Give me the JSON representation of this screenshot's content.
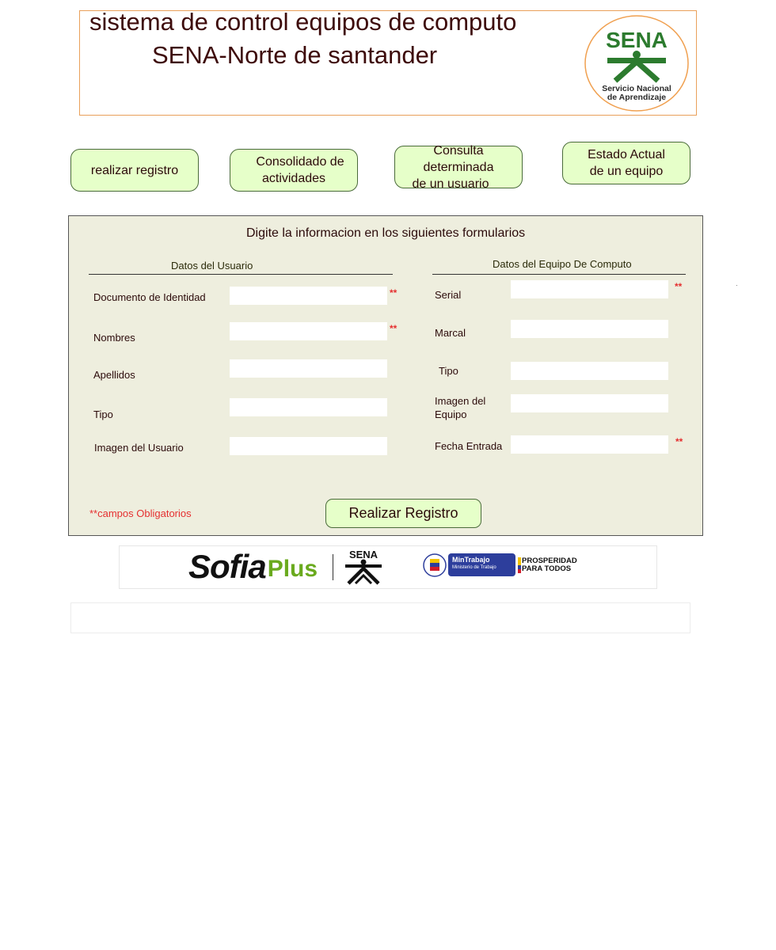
{
  "header": {
    "title_line1": "sistema de control equipos de computo",
    "title_line2": "SENA-Norte de santander",
    "logo": {
      "icon": "sena-logo-icon",
      "brand": "SENA",
      "line1": "Servicio Nacional",
      "line2": "de Aprendizaje",
      "color": "#2c7b2e",
      "ring_color": "#f0a050"
    }
  },
  "nav": {
    "register": "realizar registro",
    "consolidated_l1": "Consolidado de",
    "consolidated_l2": "actividades",
    "query_l1": "Consulta determinada",
    "query_l2": "de un usuario",
    "status_l1": "Estado Actual",
    "status_l2": "de un equipo"
  },
  "form": {
    "heading": "Digite la informacion en los siguientes formularios",
    "user_section": {
      "title": "Datos del Usuario",
      "fields": [
        {
          "label": "Documento de Identidad",
          "value": "",
          "required": true
        },
        {
          "label": "Nombres",
          "value": "",
          "required": true
        },
        {
          "label": "Apellidos",
          "value": "",
          "required": false
        },
        {
          "label": "Tipo",
          "value": "",
          "required": false
        },
        {
          "label": "Imagen del Usuario",
          "value": "",
          "required": false
        }
      ]
    },
    "equipment_section": {
      "title": "Datos del Equipo De Computo",
      "fields": [
        {
          "label": "Serial",
          "value": "",
          "required": true
        },
        {
          "label": "Marcal",
          "value": "",
          "required": false
        },
        {
          "label": "Tipo",
          "value": "",
          "required": false
        },
        {
          "label_l1": "Imagen del",
          "label_l2": "Equipo",
          "value": "",
          "required": false
        },
        {
          "label": "Fecha Entrada",
          "value": "",
          "required": true
        }
      ]
    },
    "required_marker": "**",
    "required_note": "**campos Obligatorios",
    "submit_label": "Realizar Registro"
  },
  "footer": {
    "sofia": "Sofia",
    "plus": "Plus",
    "sena": "SENA",
    "mintrabajo": "MinTrabajo",
    "mintrabajo_sub": "Ministerio de Trabajo",
    "prosperidad_l1": "PROSPERIDAD",
    "prosperidad_l2": "PARA TODOS",
    "colors": {
      "plus_green": "#6aaa1e",
      "mintrabajo_bg": "#2d3e9c",
      "sena_green": "#2c7b2e"
    }
  }
}
